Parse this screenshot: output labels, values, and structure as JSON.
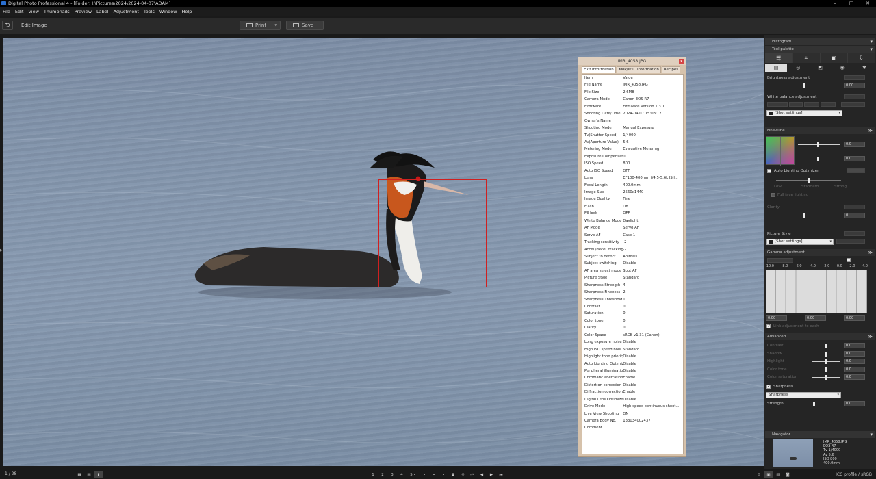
{
  "window": {
    "title": "Digital Photo Professional 4 - [Folder: I:\\Pictures\\2024\\2024-04-07\\ADAM]",
    "controls": [
      "–",
      "□",
      "✕"
    ]
  },
  "menu": [
    "File",
    "Edit",
    "View",
    "Thumbnails",
    "Preview",
    "Label",
    "Adjustment",
    "Tools",
    "Window",
    "Help"
  ],
  "toolbar": {
    "mode_title": "Edit Image",
    "print_label": "Print",
    "print_caret": "▾",
    "save_label": "Save",
    "back_glyph": "⮌"
  },
  "exif_panel": {
    "title": "IMR_4058.JPG",
    "close_glyph": "x",
    "tabs": [
      "Exif Information",
      "XMP/IPTC Information",
      "Recipes"
    ],
    "header": {
      "item": "Item",
      "value": "Value"
    },
    "rows": [
      {
        "k": "File Name",
        "v": "IMR_4058.JPG"
      },
      {
        "k": "File Size",
        "v": "2.6MB"
      },
      {
        "k": "Camera Model",
        "v": "Canon EOS R7"
      },
      {
        "k": "Firmware",
        "v": "Firmware Version 1.3.1"
      },
      {
        "k": "Shooting Date/Time",
        "v": "2024-04-07 15:08:12"
      },
      {
        "k": "Owner's Name",
        "v": ""
      },
      {
        "k": "Shooting Mode",
        "v": "Manual Exposure"
      },
      {
        "k": "Tv(Shutter Speed)",
        "v": "1/4000"
      },
      {
        "k": "Av(Aperture Value)",
        "v": "5.6"
      },
      {
        "k": "Metering Mode",
        "v": "Evaluative Metering"
      },
      {
        "k": "Exposure Compensati...",
        "v": "0"
      },
      {
        "k": "ISO Speed",
        "v": "800"
      },
      {
        "k": "Auto ISO Speed",
        "v": "OFF"
      },
      {
        "k": "Lens",
        "v": "EF100-400mm f/4.5-5.6L IS I..."
      },
      {
        "k": "Focal Length",
        "v": "400.0mm"
      },
      {
        "k": "Image Size",
        "v": "2560x1440"
      },
      {
        "k": "Image Quality",
        "v": "Fine"
      },
      {
        "k": "Flash",
        "v": "Off"
      },
      {
        "k": "FE lock",
        "v": "OFF"
      },
      {
        "k": "White Balance Mode",
        "v": "Daylight"
      },
      {
        "k": "AF Mode",
        "v": "Servo AF"
      },
      {
        "k": "Servo AF",
        "v": "Case 1"
      },
      {
        "k": "Tracking sensitivity",
        "v": "-2"
      },
      {
        "k": "Accel./decel. tracking",
        "v": "-2"
      },
      {
        "k": "Subject to detect",
        "v": "Animals"
      },
      {
        "k": "Subject switching",
        "v": "Disable"
      },
      {
        "k": "AF area select mode",
        "v": "Spot AF"
      },
      {
        "k": "Picture Style",
        "v": "Standard"
      },
      {
        "k": "Sharpness Strength",
        "v": "4"
      },
      {
        "k": "Sharpness Fineness",
        "v": "2"
      },
      {
        "k": "Sharpness Threshold",
        "v": "1"
      },
      {
        "k": "Contrast",
        "v": "0"
      },
      {
        "k": "Saturation",
        "v": "0"
      },
      {
        "k": "Color tone",
        "v": "0"
      },
      {
        "k": "Clarity",
        "v": "0"
      },
      {
        "k": "Color Space",
        "v": "sRGB v1.31 (Canon)"
      },
      {
        "k": "Long exposure noise ...",
        "v": "Disable"
      },
      {
        "k": "High ISO speed nois...",
        "v": "Standard"
      },
      {
        "k": "Highlight tone priority",
        "v": "Disable"
      },
      {
        "k": "Auto Lighting Optimizer",
        "v": "Disable"
      },
      {
        "k": "Peripheral illumination...",
        "v": "Disable"
      },
      {
        "k": "Chromatic aberration ...",
        "v": "Enable"
      },
      {
        "k": "Distortion correction",
        "v": "Disable"
      },
      {
        "k": "Diffraction correction",
        "v": "Enable"
      },
      {
        "k": "Digital Lens Optimizer",
        "v": "Disable"
      },
      {
        "k": "Drive Mode",
        "v": "High-speed continuous shoot..."
      },
      {
        "k": "Live View Shooting",
        "v": "ON"
      },
      {
        "k": "Camera Body No.",
        "v": "133034002437"
      },
      {
        "k": "Comment",
        "v": ""
      }
    ]
  },
  "right_panel": {
    "histogram": "Histogram",
    "tool_palette": "Tool palette",
    "brightness": {
      "label": "Brightness adjustment",
      "value": "0.00",
      "level": 0.5
    },
    "white_balance": {
      "label": "White balance adjustment",
      "combo": "[Shot settings]"
    },
    "fine_tune": {
      "label": "Fine-tune",
      "v1": "0.0",
      "v2": "0.0"
    },
    "alo": {
      "label": "Auto Lighting Optimizer",
      "low": "Low",
      "standard": "Standard",
      "strong": "Strong",
      "full": "Full face lighting"
    },
    "clarity": {
      "label": "Clarity",
      "value": "0"
    },
    "picture_style": {
      "label": "Picture Style",
      "combo": "[Shot settings]"
    },
    "gamma": {
      "label": "Gamma adjustment",
      "axis": [
        "-10.0",
        "-8.0",
        "-6.0",
        "-4.0",
        "-2.0",
        "0.0",
        "2.0",
        "4.0"
      ],
      "v1": "0.00",
      "v2": "0.00",
      "v3": "0.00",
      "link": "Link adjustment to each"
    },
    "advanced": {
      "label": "Advanced",
      "items": [
        {
          "label": "Contrast",
          "value": "0.0"
        },
        {
          "label": "Shadow",
          "value": "0.0"
        },
        {
          "label": "Highlight",
          "value": "0.0"
        },
        {
          "label": "Color tone",
          "value": "0.0"
        },
        {
          "label": "Color saturation",
          "value": "0.0"
        }
      ]
    },
    "sharpness": {
      "label": "Sharpness",
      "combo": "Sharpness",
      "strength": "Strength",
      "value": "0.0"
    },
    "navigator": {
      "label": "Navigator",
      "info": [
        "IMR_4058.JPG",
        "EOS R7",
        "Tv 1/4000",
        "Av 5.6",
        "ISO 800",
        "400.0mm"
      ]
    }
  },
  "status": {
    "count": "1 / 28",
    "zoom_icons": [
      "1",
      "2",
      "3",
      "4",
      "5"
    ],
    "stars": [
      "•",
      "•",
      "•",
      "•",
      "•"
    ],
    "icc": "ICC profile / sRGB"
  }
}
